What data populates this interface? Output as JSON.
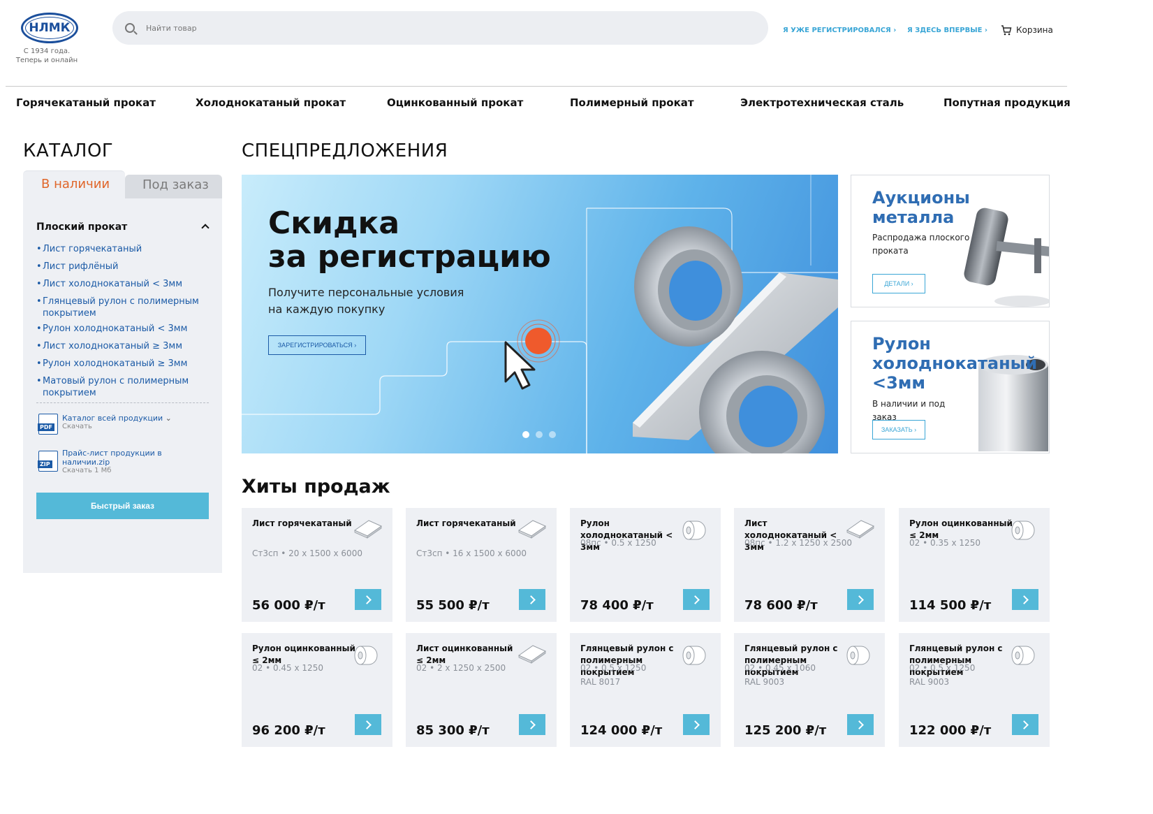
{
  "header": {
    "logo": "НЛМК",
    "tagline_line1": "С 1934 года.",
    "tagline_line2": "Теперь и онлайн",
    "search_placeholder": "Найти товар",
    "login_link": "Я УЖЕ РЕГИСТРИРОВАЛСЯ ›",
    "register_link": "Я ЗДЕСЬ ВПЕРВЫЕ ›",
    "cart_label": "Корзина"
  },
  "nav": [
    "Горячекатаный прокат",
    "Холоднокатаный прокат",
    "Оцинкованный прокат",
    "Полимерный прокат",
    "Электротехническая сталь",
    "Попутная продукция"
  ],
  "catalog": {
    "title": "КАТАЛОГ",
    "tab_active": "В наличии",
    "tab_inactive": "Под заказ",
    "group": "Плоский прокат",
    "items": [
      "Лист горячекатаный",
      "Лист рифлёный",
      "Лист холоднокатаный < 3мм",
      "Глянцевый рулон с полимерным покрытием",
      "Рулон холоднокатаный < 3мм",
      "Лист холоднокатаный ≥ 3мм",
      "Рулон холоднокатаный ≥ 3мм",
      "Матовый рулон с полимерным покрытием"
    ],
    "files": [
      {
        "badge": "PDF",
        "title": "Каталог всей продукции",
        "sub": "Скачать"
      },
      {
        "badge": "ZIP",
        "title": "Прайс-лист продукции в наличии.zip",
        "sub": "Скачать 1 Мб"
      }
    ],
    "quick_order": "Быстрый заказ"
  },
  "offers": {
    "title": "СПЕЦПРЕДЛОЖЕНИЯ",
    "banner": {
      "title_line1": "Скидка",
      "title_line2": "за регистрацию",
      "subtitle_line1": "Получите персональные условия",
      "subtitle_line2": "на каждую покупку",
      "button": "ЗАРЕГИСТРИРОВАТЬСЯ ›",
      "slides": 3,
      "active_slide": 1
    },
    "side": [
      {
        "title_line1": "Аукционы",
        "title_line2": "металла",
        "sub": "Распродажа плоского проката",
        "button": "ДЕТАЛИ ›"
      },
      {
        "title_line1": "Рулон",
        "title_line2": "холоднокатаный",
        "title_line3": "<3мм",
        "sub": "В наличии и под заказ",
        "button": "ЗАКАЗАТЬ ›"
      }
    ]
  },
  "hits": {
    "title": "Хиты продаж",
    "products": [
      {
        "title": "Лист горячекатаный",
        "spec1": "Ст3сп  • 20 x 1500 x 6000",
        "spec2": "",
        "price": "56 000 ₽/т",
        "icon": "sheet-icon"
      },
      {
        "title": "Лист горячекатаный",
        "spec1": "Ст3сп  • 16 x 1500 x 6000",
        "spec2": "",
        "price": "55 500 ₽/т",
        "icon": "sheet-icon"
      },
      {
        "title": "Рулон холоднокатаный < 3мм",
        "spec1": "08пс  • 0.5 x 1250",
        "spec2": "",
        "price": "78 400 ₽/т",
        "icon": "coil-icon"
      },
      {
        "title": "Лист холоднокатаный < 3мм",
        "spec1": "08пс  • 1.2 x 1250 x 2500",
        "spec2": "",
        "price": "78 600 ₽/т",
        "icon": "sheet-icon"
      },
      {
        "title": "Рулон оцинкованный ≤ 2мм",
        "spec1": "02  • 0.35 x 1250",
        "spec2": "",
        "price": "114 500 ₽/т",
        "icon": "coil-icon"
      },
      {
        "title": "Рулон оцинкованный ≤ 2мм",
        "spec1": "02  • 0.45 x 1250",
        "spec2": "",
        "price": "96 200 ₽/т",
        "icon": "coil-icon"
      },
      {
        "title": "Лист оцинкованный ≤ 2мм",
        "spec1": "02  • 2 x 1250 x 2500",
        "spec2": "",
        "price": "85 300 ₽/т",
        "icon": "sheet-icon"
      },
      {
        "title": "Глянцевый рулон с полимерным покрытием",
        "spec1": "02  • 0.5 x 1250",
        "spec2": "RAL 8017",
        "price": "124 000 ₽/т",
        "icon": "coil-icon"
      },
      {
        "title": "Глянцевый рулон с полимерным покрытием",
        "spec1": "02  • 0.45 x 1060",
        "spec2": "RAL 9003",
        "price": "125 200 ₽/т",
        "icon": "coil-icon"
      },
      {
        "title": "Глянцевый рулон с полимерным покрытием",
        "spec1": "02  • 0.5 x 1250",
        "spec2": "RAL 9003",
        "price": "122 000 ₽/т",
        "icon": "coil-icon"
      }
    ]
  },
  "colors": {
    "brand": "#1b4f9c",
    "accent": "#54b9d8",
    "link": "#1b5aa6",
    "active_tab": "#e0662a"
  }
}
